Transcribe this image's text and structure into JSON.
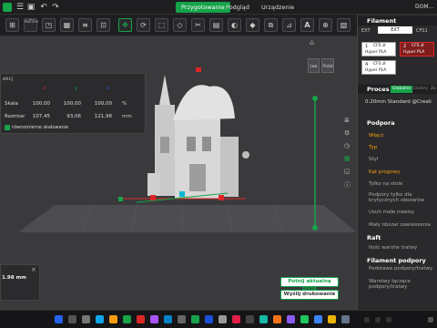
{
  "topbar": {
    "tabs": [
      {
        "label": "Przygotowanie",
        "active": true
      },
      {
        "label": "Podgląd",
        "active": false
      },
      {
        "label": "Urządzenie",
        "active": false
      }
    ],
    "user": "DOM..."
  },
  "toolbar": {
    "labels": {
      "auto": "AUTO",
      "a": "A"
    }
  },
  "view": {
    "btn_left": "Lew",
    "btn_right": "Przód"
  },
  "scale_panel": {
    "title": "ekcj",
    "axes": {
      "x": "x",
      "y": "y",
      "z": "z"
    },
    "rows": [
      {
        "label": "Skala",
        "x": "100,00",
        "y": "100,00",
        "z": "100,00",
        "unit": "%"
      },
      {
        "label": "Rozmiar",
        "x": "107,45",
        "y": "93,06",
        "z": "121,98",
        "unit": "mm"
      }
    ],
    "checkbox": "równomierne skalowanie"
  },
  "bottom_box": {
    "value": "1.98 mm",
    "close": "×"
  },
  "buttons": {
    "slice": "Potnij aktualną płytę",
    "send": "Wyślij drukowanie"
  },
  "filament": {
    "title": "Filament",
    "ext": "EXT",
    "ext_label": "EXT",
    "cfs": "CFS1",
    "slots": [
      {
        "num": "1",
        "code": "CFS zł",
        "name": "Hyper PLA"
      },
      {
        "num": "2",
        "code": "CFS zł",
        "name": "Hyper PLA"
      },
      {
        "num": "4",
        "code": "CFS zł",
        "name": "Hyper PLA"
      }
    ]
  },
  "process": {
    "title": "Proces",
    "tab_global": "Globalne",
    "tab_objects": "Obiekty",
    "tab_z": "Za",
    "preset": "0.20mm Standard @Creali"
  },
  "support": {
    "title": "Podpora",
    "items": [
      {
        "label": "Włącz",
        "orange": true
      },
      {
        "label": "Typ",
        "orange": true
      },
      {
        "label": "Styl",
        "orange": false
      },
      {
        "label": "Kąt progowy",
        "orange": true
      },
      {
        "label": "Tylko na stole",
        "orange": false
      },
      {
        "label": "Podpory tylko dla krytycznych obszarów",
        "orange": false
      },
      {
        "label": "Usuń małe nawisy",
        "orange": false
      },
      {
        "label": "Mały obszar zawieszenia",
        "orange": false
      }
    ]
  },
  "raft": {
    "title": "Raft",
    "items": [
      {
        "label": "Ilość warstw tratwy"
      }
    ]
  },
  "filament_support": {
    "title": "Filament podpory",
    "items": [
      {
        "label": "Podstawa podpory/tratwy"
      },
      {
        "label": "Warstwy łączące podpory/tratwy"
      }
    ]
  },
  "colors": {
    "accent": "#16a34a",
    "orange": "#f59e0b",
    "red": "#dc2626",
    "blue": "#2563eb"
  }
}
